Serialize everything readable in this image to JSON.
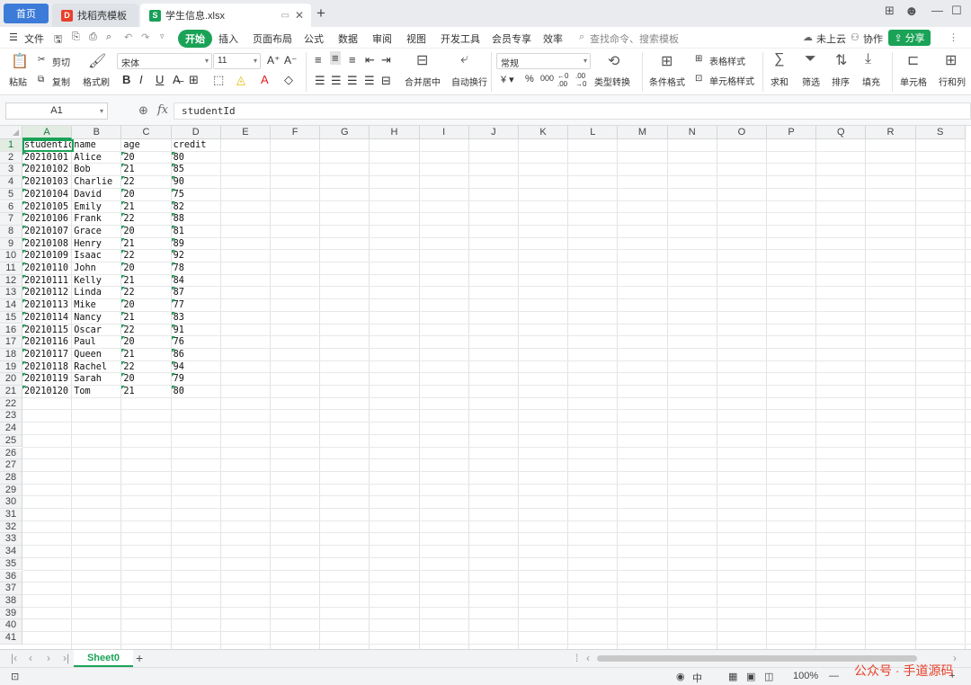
{
  "tabs": {
    "home": "首页",
    "template": "找稻壳模板",
    "file": "学生信息.xlsx"
  },
  "menu": {
    "file": "文件",
    "start": "开始",
    "insert": "插入",
    "layout": "页面布局",
    "formula": "公式",
    "data": "数据",
    "review": "审阅",
    "view": "视图",
    "devtools": "开发工具",
    "member": "会员专享",
    "efficiency": "效率",
    "search": "查找命令、搜索模板",
    "cloud": "未上云",
    "collab": "协作",
    "share": "分享"
  },
  "ribbon": {
    "paste": "粘贴",
    "cut": "剪切",
    "copy": "复制",
    "format_painter": "格式刷",
    "font": "宋体",
    "font_size": "11",
    "merge_center": "合并居中",
    "wrap": "自动换行",
    "number_format": "常规",
    "type_convert": "类型转换",
    "cond_format": "条件格式",
    "table_style": "表格样式",
    "cell_style": "单元格样式",
    "sum": "求和",
    "filter": "筛选",
    "sort": "排序",
    "fill": "填充",
    "cell": "单元格",
    "rows_cols": "行和列"
  },
  "formula_bar": {
    "name_box": "A1",
    "content": "studentId"
  },
  "columns": [
    "A",
    "B",
    "C",
    "D",
    "E",
    "F",
    "G",
    "H",
    "I",
    "J",
    "K",
    "L",
    "M",
    "N",
    "O",
    "P",
    "Q",
    "R",
    "S"
  ],
  "row_count": 41,
  "sheet": {
    "header": [
      "studentId",
      "name",
      "age",
      "credit"
    ],
    "rows": [
      [
        "20210101",
        "Alice",
        "20",
        "80"
      ],
      [
        "20210102",
        "Bob",
        "21",
        "85"
      ],
      [
        "20210103",
        "Charlie",
        "22",
        "90"
      ],
      [
        "20210104",
        "David",
        "20",
        "75"
      ],
      [
        "20210105",
        "Emily",
        "21",
        "82"
      ],
      [
        "20210106",
        "Frank",
        "22",
        "88"
      ],
      [
        "20210107",
        "Grace",
        "20",
        "81"
      ],
      [
        "20210108",
        "Henry",
        "21",
        "89"
      ],
      [
        "20210109",
        "Isaac",
        "22",
        "92"
      ],
      [
        "20210110",
        "John",
        "20",
        "78"
      ],
      [
        "20210111",
        "Kelly",
        "21",
        "84"
      ],
      [
        "20210112",
        "Linda",
        "22",
        "87"
      ],
      [
        "20210113",
        "Mike",
        "20",
        "77"
      ],
      [
        "20210114",
        "Nancy",
        "21",
        "83"
      ],
      [
        "20210115",
        "Oscar",
        "22",
        "91"
      ],
      [
        "20210116",
        "Paul",
        "20",
        "76"
      ],
      [
        "20210117",
        "Queen",
        "21",
        "86"
      ],
      [
        "20210118",
        "Rachel",
        "22",
        "94"
      ],
      [
        "20210119",
        "Sarah",
        "20",
        "79"
      ],
      [
        "20210120",
        "Tom",
        "21",
        "80"
      ]
    ]
  },
  "sheet_tab": "Sheet0",
  "status": {
    "zoom": "100%",
    "lang": "中"
  },
  "watermark": "公众号 · 手道源码",
  "colors": {
    "accent": "#1aa357",
    "home_tab": "#3d7bd8"
  }
}
